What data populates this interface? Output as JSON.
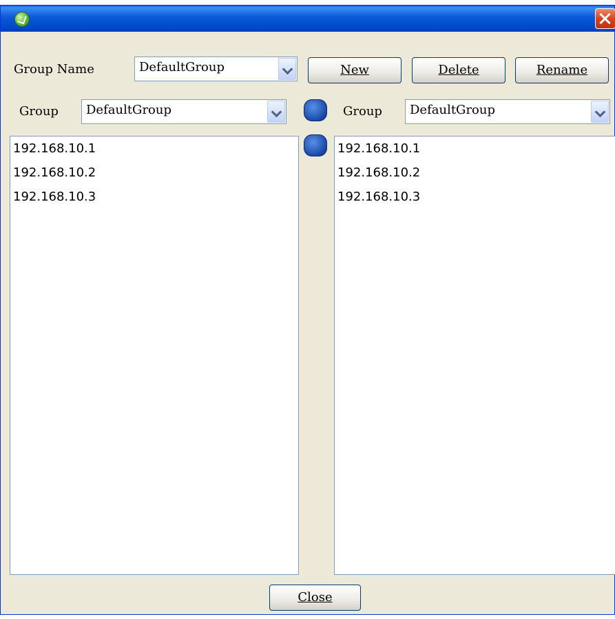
{
  "window": {
    "title": ""
  },
  "group_name": {
    "label": "Group Name",
    "value": "DefaultGroup"
  },
  "buttons": {
    "new": "New",
    "delete": "Delete",
    "rename": "Rename",
    "close": "Close"
  },
  "left": {
    "label": "Group",
    "value": "DefaultGroup",
    "items": [
      "192.168.10.1",
      "192.168.10.2",
      "192.168.10.3"
    ]
  },
  "right": {
    "label": "Group",
    "value": "DefaultGroup",
    "items": [
      "192.168.10.1",
      "192.168.10.2",
      "192.168.10.3"
    ]
  },
  "icons": [
    "app-icon",
    "close-icon",
    "chevron-down-icon",
    "move-right-icon",
    "move-left-icon"
  ],
  "colors": {
    "titlebar": "#0a58d8",
    "dialog_bg": "#ece9d8",
    "close_button": "#d9431e"
  }
}
